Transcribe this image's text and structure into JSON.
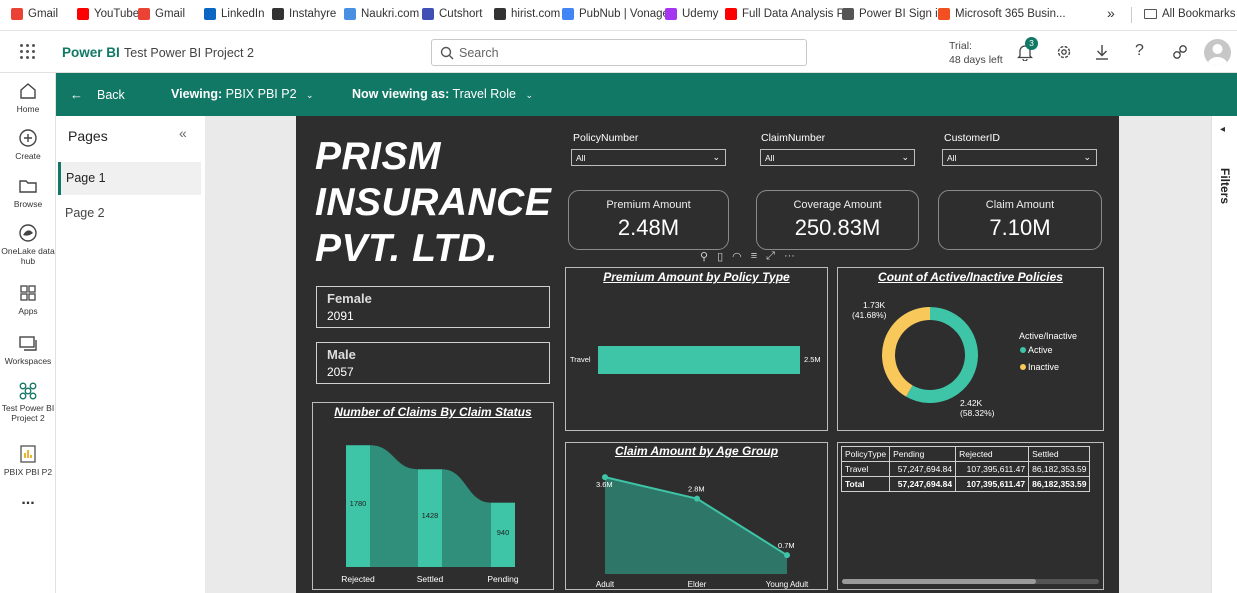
{
  "bookmarks": {
    "items": [
      {
        "label": "Gmail",
        "color": "#ea4335"
      },
      {
        "label": "YouTube",
        "color": "#ff0000"
      },
      {
        "label": "Gmail",
        "color": "#ea4335"
      },
      {
        "label": "LinkedIn",
        "color": "#0a66c2"
      },
      {
        "label": "Instahyre",
        "color": "#333333"
      },
      {
        "label": "Naukri.com",
        "color": "#4a90e2"
      },
      {
        "label": "Cutshort",
        "color": "#3f51b5"
      },
      {
        "label": "hirist.com",
        "color": "#333333"
      },
      {
        "label": "PubNub | Vonage",
        "color": "#4285f4"
      },
      {
        "label": "Udemy",
        "color": "#a435f0"
      },
      {
        "label": "Full Data Analysis P...",
        "color": "#ff0000"
      },
      {
        "label": "Power BI Sign in",
        "color": "#555555"
      },
      {
        "label": "Microsoft 365 Busin...",
        "color": "#f25022"
      }
    ],
    "more": "»",
    "all_bookmarks": "All Bookmarks"
  },
  "topbar": {
    "app_name": "Power BI",
    "workspace": "Test Power BI Project 2",
    "search_placeholder": "Search",
    "trial_line1": "Trial:",
    "trial_line2": "48 days left",
    "notification_count": "3"
  },
  "rail": {
    "items": [
      {
        "label": "Home"
      },
      {
        "label": "Create"
      },
      {
        "label": "Browse"
      },
      {
        "label": "OneLake data hub"
      },
      {
        "label": "Apps"
      },
      {
        "label": "Workspaces"
      },
      {
        "label": "Test Power BI Project 2"
      },
      {
        "label": "PBIX PBI P2"
      }
    ],
    "more": "..."
  },
  "viewbar": {
    "back": "Back",
    "viewing_label": "Viewing:",
    "viewing_value": "PBIX PBI P2",
    "now_viewing_label": "Now viewing as:",
    "now_viewing_value": "Travel Role"
  },
  "pages": {
    "title": "Pages",
    "items": [
      "Page 1",
      "Page 2"
    ],
    "active": "Page 1"
  },
  "filters_label": "Filters",
  "report": {
    "title_lines": [
      "PRISM",
      "INSURANCE",
      "PVT. LTD."
    ],
    "slicers": [
      {
        "label": "PolicyNumber",
        "value": "All"
      },
      {
        "label": "ClaimNumber",
        "value": "All"
      },
      {
        "label": "CustomerID",
        "value": "All"
      }
    ],
    "cards": [
      {
        "label": "Premium Amount",
        "value": "2.48M"
      },
      {
        "label": "Coverage Amount",
        "value": "250.83M"
      },
      {
        "label": "Claim Amount",
        "value": "7.10M"
      }
    ],
    "gender_cards": [
      {
        "label": "Female",
        "value": "2091"
      },
      {
        "label": "Male",
        "value": "2057"
      }
    ],
    "matrix": {
      "headers": [
        "PolicyType",
        "Pending",
        "Rejected",
        "Settled"
      ],
      "rows": [
        [
          "Travel",
          "57,247,694.84",
          "107,395,611.47",
          "86,182,353.59"
        ],
        [
          "Total",
          "57,247,694.84",
          "107,395,611.47",
          "86,182,353.59"
        ]
      ]
    },
    "colors": {
      "teal": "#3ec4a6",
      "yellow": "#f8c85a",
      "bg": "#2e2e2e"
    }
  },
  "chart_data": [
    {
      "type": "bar",
      "title": "Premium Amount by Policy Type",
      "orientation": "horizontal",
      "categories": [
        "Travel"
      ],
      "values": [
        2.5
      ],
      "value_labels": [
        "2.5M"
      ],
      "unit": "M"
    },
    {
      "type": "pie",
      "title": "Count of Active/Inactive Policies",
      "legend_title": "Active/Inactive",
      "legend_position": "right",
      "slices": [
        {
          "name": "Active",
          "value": 2.42,
          "label": "2.42K",
          "pct": "(58.32%)",
          "color": "#3ec4a6"
        },
        {
          "name": "Inactive",
          "value": 1.73,
          "label": "1.73K",
          "pct": "(41.68%)",
          "color": "#f8c85a"
        }
      ]
    },
    {
      "type": "bar",
      "title": "Number of Claims By Claim Status",
      "variant": "ribbon",
      "categories": [
        "Rejected",
        "Settled",
        "Pending"
      ],
      "values": [
        1780,
        1428,
        940
      ],
      "ylim": [
        0,
        1900
      ]
    },
    {
      "type": "area",
      "title": "Claim Amount by Age Group",
      "categories": [
        "Adult",
        "Elder",
        "Young Adult"
      ],
      "values": [
        3.6,
        2.8,
        0.7
      ],
      "value_labels": [
        "3.6M",
        "2.8M",
        "0.7M"
      ],
      "ylim": [
        0,
        4.2
      ]
    }
  ]
}
